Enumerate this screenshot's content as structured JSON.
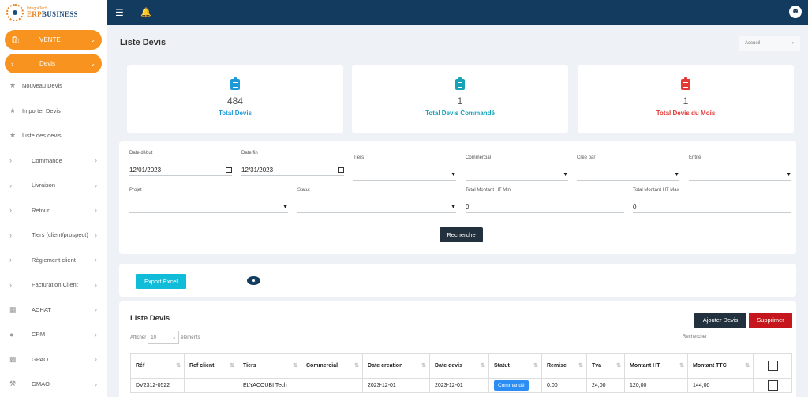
{
  "logo": {
    "small": "IntegraTech",
    "brand_a": "ERP",
    "brand_b": "BUSINESS"
  },
  "sidebar": {
    "main_items": [
      {
        "label": "VENTE",
        "icon": "shopping-bag-icon"
      },
      {
        "label": "Devis",
        "icon": "chevron-right-icon"
      }
    ],
    "star_items": [
      {
        "label": "Nouveau Devis"
      },
      {
        "label": "Importer Devis"
      },
      {
        "label": "Liste des devis"
      }
    ],
    "items": [
      {
        "label": "Commande"
      },
      {
        "label": "Livraison"
      },
      {
        "label": "Retour"
      },
      {
        "label": "Tiers (client/prospect)"
      },
      {
        "label": "Règlement client"
      },
      {
        "label": "Facturation Client"
      }
    ],
    "modules": [
      {
        "label": "ACHAT",
        "icon": "basket-icon"
      },
      {
        "label": "CRM",
        "icon": "lightbulb-icon"
      },
      {
        "label": "GPAO",
        "icon": "factory-icon"
      },
      {
        "label": "GMAO",
        "icon": "wrench-icon"
      }
    ]
  },
  "page": {
    "title": "Liste Devis",
    "breadcrumb": "Accueil"
  },
  "stats": [
    {
      "value": "484",
      "label": "Total Devis",
      "color": "#1e9bd7"
    },
    {
      "value": "1",
      "label": "Total Devis Commandé",
      "color": "#17a2b8"
    },
    {
      "value": "1",
      "label": "Total Devis du Mois",
      "color": "#e53935"
    }
  ],
  "filters": {
    "date_debut": {
      "label": "Date début",
      "value": "12/01/2023"
    },
    "date_fin": {
      "label": "Date fin",
      "value": "12/31/2023"
    },
    "tiers": {
      "label": "Tiers",
      "value": ""
    },
    "commercial": {
      "label": "Commercial",
      "value": ""
    },
    "cree_par": {
      "label": "Crée par",
      "value": ""
    },
    "entite": {
      "label": "Entite",
      "value": ""
    },
    "projet": {
      "label": "Projet",
      "value": ""
    },
    "statut": {
      "label": "Statut",
      "value": ""
    },
    "montant_min": {
      "label": "Total Montant HT Min",
      "value": "0"
    },
    "montant_max": {
      "label": "Total Montant HT Max",
      "value": "0"
    },
    "search_button": "Recherche"
  },
  "actions": {
    "export_excel": "Export Excel"
  },
  "list": {
    "title": "Liste Devis",
    "add_button": "Ajouter Devis",
    "delete_button": "Supprimer",
    "length_prefix": "Afficher",
    "length_value": "10",
    "length_suffix": "éléments",
    "search_label": "Rechercher :",
    "columns": [
      "Réf",
      "Ref client",
      "Tiers",
      "Commercial",
      "Date creation",
      "Date devis",
      "Statut",
      "Remise",
      "Tva",
      "Montant HT",
      "Montant TTC"
    ],
    "rows": [
      {
        "ref": "DV2312-0522",
        "ref_client": "",
        "tiers": "ELYACOUBI Tech",
        "commercial": "",
        "date_creation": "2023-12-01",
        "date_devis": "2023-12-01",
        "statut": "Commandé",
        "remise": "0.00",
        "tva": "24,00",
        "montant_ht": "120,00",
        "montant_ttc": "144,00"
      }
    ]
  }
}
